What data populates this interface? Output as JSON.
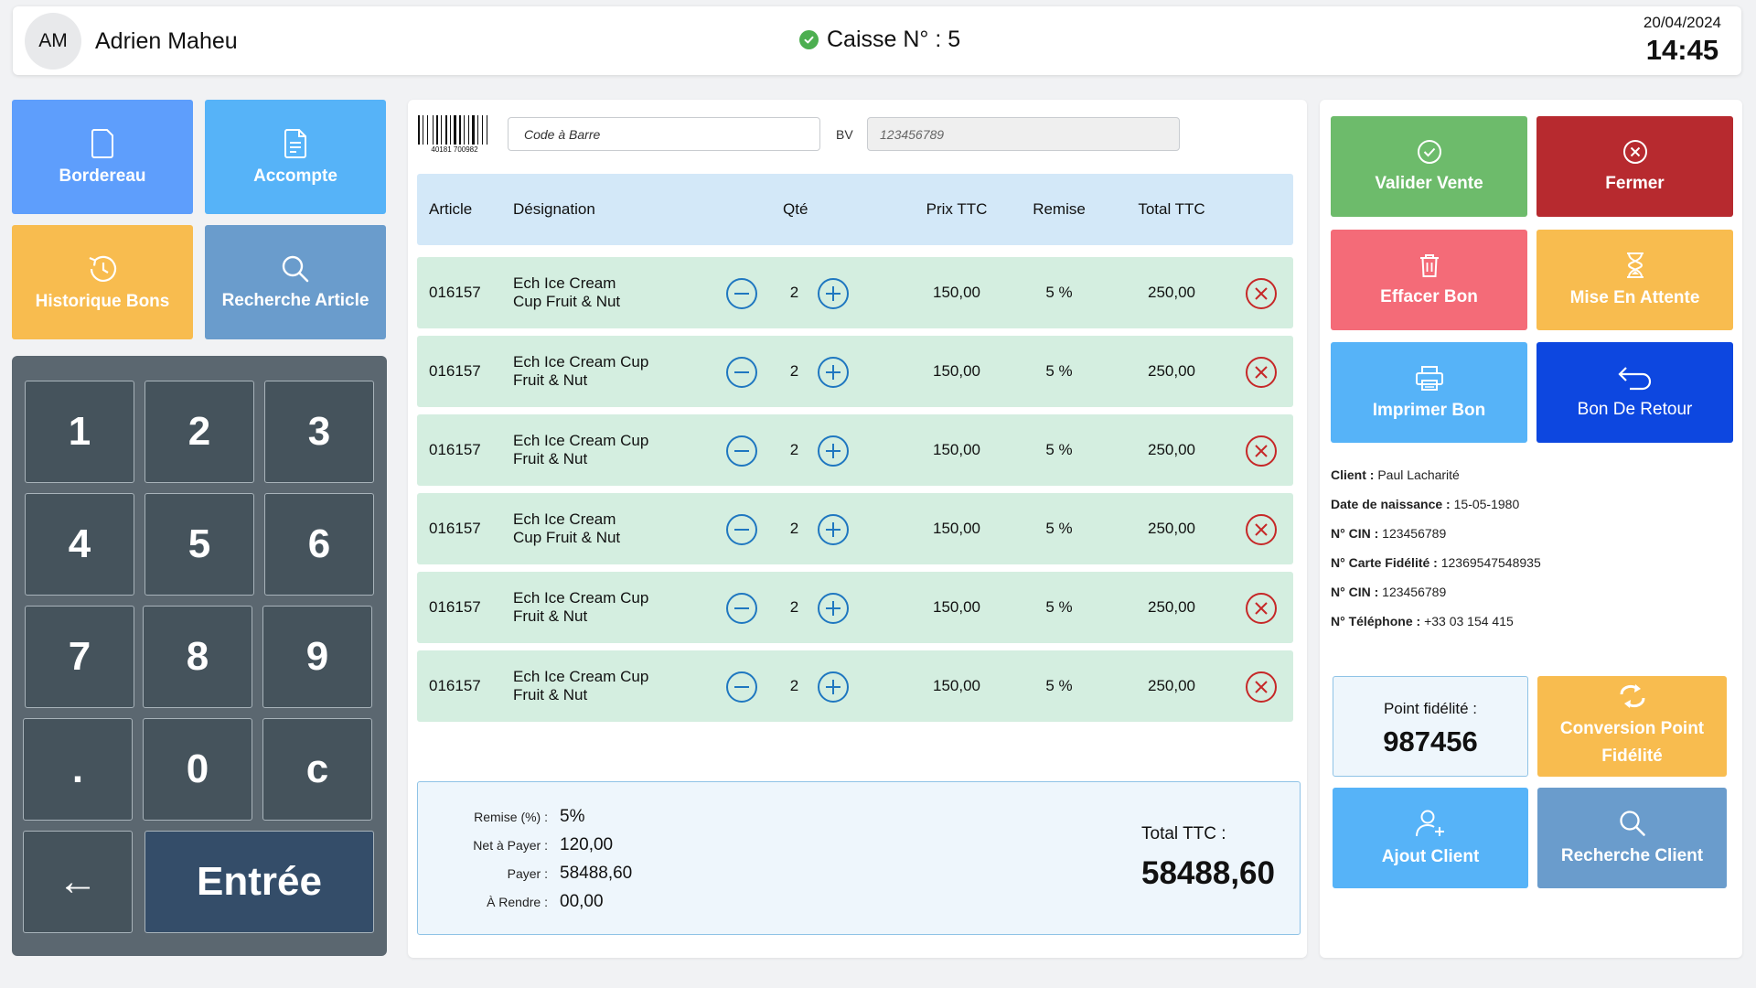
{
  "header": {
    "avatar_initials": "AM",
    "user_name": "Adrien Maheu",
    "register_label": "Caisse N° : 5",
    "date": "20/04/2024",
    "time": "14:45"
  },
  "tiles": {
    "bordereau": "Bordereau",
    "accompte": "Accompte",
    "historique": "Historique Bons",
    "recherche_article": "Recherche Article"
  },
  "keypad": [
    "1",
    "2",
    "3",
    "4",
    "5",
    "6",
    "7",
    "8",
    "9",
    ".",
    "0",
    "c",
    "←",
    "Entrée"
  ],
  "inputs": {
    "barcode_placeholder": "Code à Barre",
    "barcode_number": "40181 700982",
    "bv_label": "BV",
    "bv_placeholder": "123456789"
  },
  "table": {
    "headers": [
      "Article",
      "Désignation",
      "Qté",
      "Prix TTC",
      "Remise",
      "Total TTC"
    ],
    "rows": [
      {
        "article": "016157",
        "designation": "Ech Ice Cream\nCup Fruit & Nut",
        "qty": "2",
        "prix": "150,00",
        "remise": "5 %",
        "total": "250,00"
      },
      {
        "article": "016157",
        "designation": "Ech Ice Cream Cup\n Fruit & Nut",
        "qty": "2",
        "prix": "150,00",
        "remise": "5 %",
        "total": "250,00"
      },
      {
        "article": "016157",
        "designation": "Ech Ice Cream Cup\nFruit & Nut",
        "qty": "2",
        "prix": "150,00",
        "remise": "5 %",
        "total": "250,00"
      },
      {
        "article": "016157",
        "designation": "Ech Ice Cream\nCup Fruit & Nut",
        "qty": "2",
        "prix": "150,00",
        "remise": "5 %",
        "total": "250,00"
      },
      {
        "article": "016157",
        "designation": "Ech Ice Cream Cup\nFruit & Nut",
        "qty": "2",
        "prix": "150,00",
        "remise": "5 %",
        "total": "250,00"
      },
      {
        "article": "016157",
        "designation": "Ech Ice Cream Cup\nFruit & Nut",
        "qty": "2",
        "prix": "150,00",
        "remise": "5 %",
        "total": "250,00"
      }
    ]
  },
  "summary": {
    "remise_label": "Remise (%) :",
    "remise_value": "5%",
    "net_label": "Net à Payer :",
    "net_value": "120,00",
    "payer_label": "Payer :",
    "payer_value": "58488,60",
    "rendre_label": "À Rendre :",
    "rendre_value": "00,00",
    "total_label": "Total TTC :",
    "total_value": "58488,60"
  },
  "actions": {
    "valider": "Valider Vente",
    "fermer": "Fermer",
    "effacer": "Effacer Bon",
    "attente": "Mise En Attente",
    "imprimer": "Imprimer Bon",
    "retour": "Bon De Retour",
    "conversion": "Conversion Point Fidélité",
    "ajout_client": "Ajout Client",
    "recherche_client": "Recherche Client"
  },
  "client": {
    "client_label": "Client :",
    "client_value": "Paul Lacharité",
    "dob_label": "Date de naissance :",
    "dob_value": "15-05-1980",
    "cin_label": "N° CIN :",
    "cin_value": "123456789",
    "carte_label": "N° Carte Fidélité :",
    "carte_value": "12369547548935",
    "cin2_label": "N° CIN :",
    "cin2_value": "123456789",
    "tel_label": "N° Téléphone :",
    "tel_value": "+33 03 154 415"
  },
  "points": {
    "label": "Point fidélité :",
    "value": "987456"
  },
  "colors": {
    "bordereau": "#5e9efc",
    "accompte": "#56b3f8",
    "historique": "#f8bc4f",
    "recherche_article": "#6a9ccc",
    "valider": "#6dbb6b",
    "fermer": "#b72a2f",
    "effacer": "#f46b78",
    "attente": "#f8bc4f",
    "imprimer": "#56b3f8",
    "retour": "#0d47e0",
    "status_ok": "#4caf50",
    "minus_plus": "#1f77c0",
    "delete": "#c62828"
  }
}
